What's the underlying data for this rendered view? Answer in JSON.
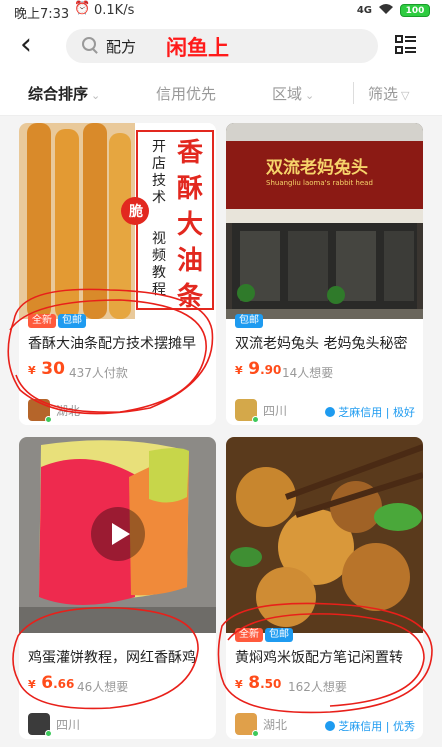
{
  "status": {
    "time": "晚上7:33",
    "speed": "0.1K/s",
    "signal": "4G",
    "battery": "100"
  },
  "search": {
    "query": "配方",
    "overlay_text": "闲鱼上"
  },
  "filters": [
    {
      "label": "综合排序",
      "active": true
    },
    {
      "label": "信用优先",
      "active": false
    },
    {
      "label": "区域",
      "active": false
    },
    {
      "label": "筛选",
      "active": false
    }
  ],
  "products": [
    {
      "title": "香酥大油条配方技术摆摊早",
      "tags": [
        "全新",
        "包邮"
      ],
      "price_int": "30",
      "price_dec": "",
      "sold": "437人付款",
      "location": "湖北",
      "banner": {
        "vertical_a": "开店技术",
        "vertical_b": "视频教程",
        "badge": "脆",
        "big": "香酥大油条"
      }
    },
    {
      "title": "双流老妈兔头 老妈兔头秘密",
      "tags": [
        "包邮"
      ],
      "price_int": "9",
      "price_dec": ".90",
      "sold": "14人想要",
      "location": "四川",
      "credit": "芝麻信用 | 极好",
      "storefront": {
        "sign": "双流老妈兔头",
        "sub": "Shuangliu laoma's rabbit head"
      }
    },
    {
      "title": "鸡蛋灌饼教程，网红香酥鸡",
      "tags": [],
      "price_int": "6",
      "price_dec": ".66",
      "sold": "46人想要",
      "location": "四川"
    },
    {
      "title": "黄焖鸡米饭配方笔记闲置转",
      "tags": [
        "全新",
        "包邮"
      ],
      "price_int": "8",
      "price_dec": ".50",
      "sold": "162人想要",
      "location": "湖北",
      "credit": "芝麻信用 | 优秀"
    }
  ],
  "colors": {
    "price": "#ff4c1a",
    "annotation": "#e8201a",
    "tag_new": "#ff5a3c",
    "tag_ship": "#1e9bf0"
  }
}
